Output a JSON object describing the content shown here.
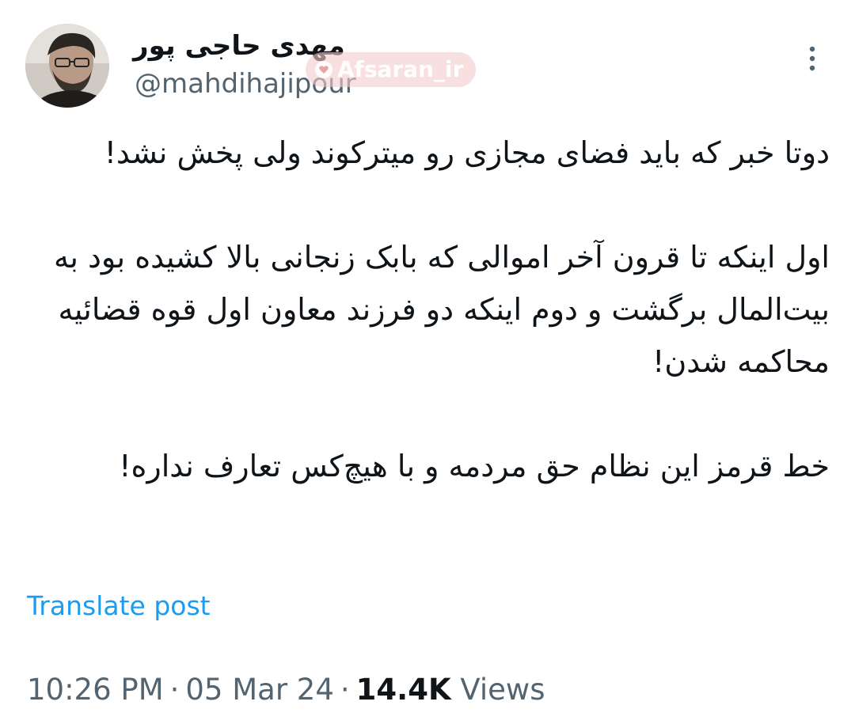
{
  "author": {
    "display_name": "مهدی حاجی پور",
    "handle": "@mahdihajipour"
  },
  "watermark": {
    "text": "Afsaran_ir"
  },
  "post": {
    "paragraphs": [
      "دوتا خبر که باید فضای مجازی رو میترکوند ولی پخش نشد!",
      "اول اینکه تا قرون آخر اموالی که بابک زنجانی بالا کشیده بود به بیت‌المال برگشت و دوم اینکه دو فرزند معاون اول قوه قضائیه محاکمه شدن!",
      "خط قرمز این نظام حق مردمه و با هیچ‌کس تعارف نداره!"
    ],
    "translate_label": "Translate post"
  },
  "meta": {
    "time": "10:26 PM",
    "date": "05 Mar 24",
    "separator": "·",
    "views_count": "14.4K",
    "views_label": "Views"
  },
  "icons": {
    "more": "more-vertical-icon",
    "watermark": "heart-badge-icon"
  },
  "colors": {
    "text_primary": "#0f1419",
    "text_secondary": "#536471",
    "link": "#1d9bf0"
  }
}
